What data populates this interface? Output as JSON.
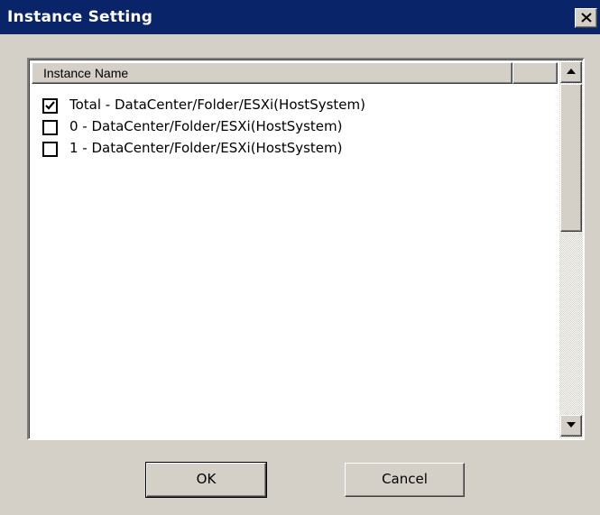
{
  "window": {
    "title": "Instance Setting",
    "close_icon": "close-icon"
  },
  "list": {
    "column_header": "Instance Name",
    "rows": [
      {
        "checked": true,
        "label": "Total - DataCenter/Folder/ESXi(HostSystem)"
      },
      {
        "checked": false,
        "label": "0 - DataCenter/Folder/ESXi(HostSystem)"
      },
      {
        "checked": false,
        "label": "1 - DataCenter/Folder/ESXi(HostSystem)"
      }
    ]
  },
  "buttons": {
    "ok_label": "OK",
    "cancel_label": "Cancel"
  },
  "colors": {
    "titlebar": "#0a246a",
    "dialog_face": "#d4d0c8"
  }
}
